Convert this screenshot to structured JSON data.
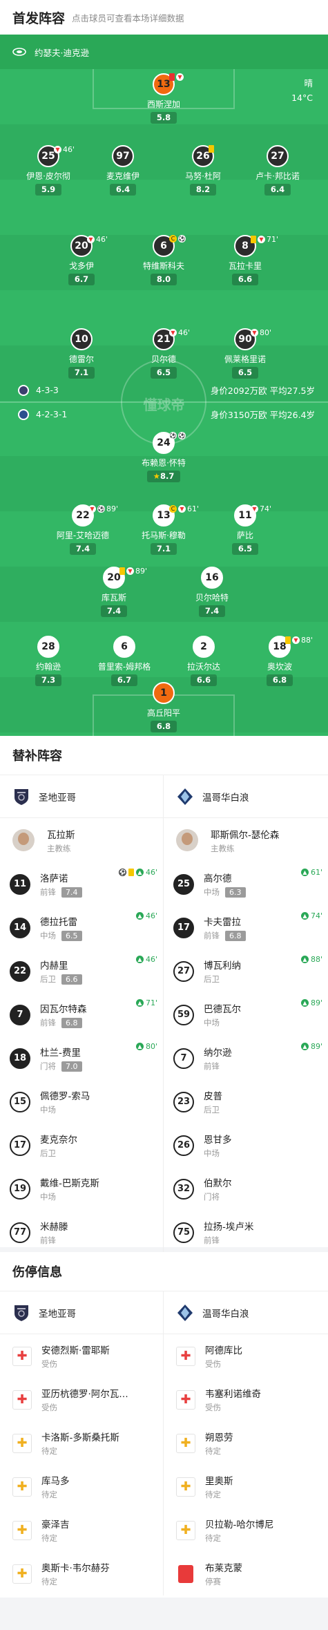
{
  "header": {
    "title": "首发阵容",
    "subtitle": "点击球员可查看本场详细数据"
  },
  "venue": {
    "name": "约瑟夫·迪克逊"
  },
  "weather": {
    "condition": "晴",
    "temp": "14°C"
  },
  "pitch": {
    "watermark": "懂球帝"
  },
  "home_team": {
    "formation": "4-3-3",
    "value": "身价2092万欧 平均27.5岁",
    "color": "#3b3f6e"
  },
  "away_team": {
    "formation": "4-2-3-1",
    "value": "身价3150万欧 平均26.4岁",
    "color": "#2c4f8e"
  },
  "home_players": [
    {
      "num": "13",
      "name": "西斯涅加",
      "rating": "5.8",
      "style": "gk",
      "events": [
        "red-card",
        "sub-out"
      ]
    },
    {
      "num": "25",
      "name": "伊恩·皮尔彻",
      "rating": "5.9",
      "style": "dark",
      "events": [
        "sub-out"
      ],
      "time": "46'"
    },
    {
      "num": "97",
      "name": "麦克维伊",
      "rating": "6.4",
      "style": "dark",
      "events": []
    },
    {
      "num": "26",
      "name": "马努·杜阿",
      "rating": "8.2",
      "style": "dark",
      "events": [
        "yellow-card"
      ]
    },
    {
      "num": "27",
      "name": "卢卡·邦比诺",
      "rating": "6.4",
      "style": "dark",
      "events": []
    },
    {
      "num": "20",
      "name": "戈多伊",
      "rating": "6.7",
      "style": "dark",
      "events": [
        "sub-out"
      ],
      "time": "46'"
    },
    {
      "num": "6",
      "name": "特维斯科夫",
      "rating": "8.0",
      "style": "dark",
      "events": [
        "captain",
        "ball"
      ]
    },
    {
      "num": "8",
      "name": "瓦拉卡里",
      "rating": "6.6",
      "style": "dark",
      "events": [
        "yellow-card",
        "sub-out"
      ],
      "time": "71'"
    },
    {
      "num": "10",
      "name": "德雷尔",
      "rating": "7.1",
      "style": "dark",
      "events": []
    },
    {
      "num": "21",
      "name": "贝尔德",
      "rating": "6.5",
      "style": "dark",
      "events": [
        "sub-out"
      ],
      "time": "46'"
    },
    {
      "num": "90",
      "name": "佩莱格里诺",
      "rating": "6.5",
      "style": "dark",
      "events": [
        "sub-out"
      ],
      "time": "80'"
    }
  ],
  "away_players": [
    {
      "num": "24",
      "name": "布赖恩·怀特",
      "rating": "8.7",
      "style": "light",
      "events": [
        "ball",
        "ball"
      ],
      "star": "★"
    },
    {
      "num": "22",
      "name": "阿里-艾哈迈德",
      "rating": "7.4",
      "style": "light",
      "events": [
        "sub-out",
        "ball"
      ],
      "time": "89'"
    },
    {
      "num": "13",
      "name": "托马斯·穆勒",
      "rating": "7.1",
      "style": "light",
      "events": [
        "captain",
        "sub-out"
      ],
      "time": "61'"
    },
    {
      "num": "11",
      "name": "萨比",
      "rating": "6.5",
      "style": "light",
      "events": [
        "sub-out"
      ],
      "time": "74'"
    },
    {
      "num": "20",
      "name": "库瓦斯",
      "rating": "7.4",
      "style": "light",
      "events": [
        "yellow-card",
        "sub-out"
      ],
      "time": "89'"
    },
    {
      "num": "16",
      "name": "贝尔哈特",
      "rating": "7.4",
      "style": "light",
      "events": []
    },
    {
      "num": "28",
      "name": "约翰逊",
      "rating": "7.3",
      "style": "light",
      "events": []
    },
    {
      "num": "6",
      "name": "普里索-姆邦格",
      "rating": "6.7",
      "style": "light",
      "events": []
    },
    {
      "num": "2",
      "name": "拉沃尔达",
      "rating": "6.6",
      "style": "light",
      "events": []
    },
    {
      "num": "18",
      "name": "奥坎波",
      "rating": "6.8",
      "style": "light",
      "events": [
        "yellow-card",
        "sub-out"
      ],
      "time": "88'"
    },
    {
      "num": "1",
      "name": "高丘阳平",
      "rating": "6.8",
      "style": "gk",
      "events": []
    }
  ],
  "subs": {
    "title": "替补阵容",
    "home": {
      "team": "圣地亚哥",
      "coach": "瓦拉斯",
      "coach_role": "主教练",
      "players": [
        {
          "num": "11",
          "name": "洛萨诺",
          "pos": "前锋",
          "rating": "7.4",
          "ev": "46'",
          "icons": [
            "ball",
            "yellow-card",
            "sub-in"
          ]
        },
        {
          "num": "14",
          "name": "德拉托雷",
          "pos": "中场",
          "rating": "6.5",
          "ev": "46'",
          "icons": [
            "sub-in"
          ]
        },
        {
          "num": "22",
          "name": "内赫里",
          "pos": "后卫",
          "rating": "6.6",
          "ev": "46'",
          "icons": [
            "sub-in"
          ]
        },
        {
          "num": "7",
          "name": "因瓦尔特森",
          "pos": "前锋",
          "rating": "6.8",
          "ev": "71'",
          "icons": [
            "sub-in"
          ]
        },
        {
          "num": "18",
          "name": "杜兰-费里",
          "pos": "门将",
          "rating": "7.0",
          "ev": "80'",
          "icons": [
            "sub-in"
          ]
        },
        {
          "num": "15",
          "name": "佩德罗-索马",
          "pos": "中场",
          "rating": "",
          "ev": "",
          "icons": []
        },
        {
          "num": "17",
          "name": "麦克奈尔",
          "pos": "后卫",
          "rating": "",
          "ev": "",
          "icons": []
        },
        {
          "num": "19",
          "name": "戴维-巴斯克斯",
          "pos": "中场",
          "rating": "",
          "ev": "",
          "icons": []
        },
        {
          "num": "77",
          "name": "米赫滕",
          "pos": "前锋",
          "rating": "",
          "ev": "",
          "icons": []
        }
      ]
    },
    "away": {
      "team": "温哥华白浪",
      "coach": "耶斯佩尔-瑟伦森",
      "coach_role": "主教练",
      "players": [
        {
          "num": "25",
          "name": "高尔德",
          "pos": "中场",
          "rating": "6.3",
          "ev": "61'",
          "icons": [
            "sub-in"
          ]
        },
        {
          "num": "17",
          "name": "卡夫雷拉",
          "pos": "前锋",
          "rating": "6.8",
          "ev": "74'",
          "icons": [
            "sub-in"
          ]
        },
        {
          "num": "27",
          "name": "博瓦利纳",
          "pos": "后卫",
          "rating": "",
          "ev": "88'",
          "icons": [
            "sub-in"
          ]
        },
        {
          "num": "59",
          "name": "巴德瓦尔",
          "pos": "中场",
          "rating": "",
          "ev": "89'",
          "icons": [
            "sub-in"
          ]
        },
        {
          "num": "7",
          "name": "纳尔逊",
          "pos": "前锋",
          "rating": "",
          "ev": "89'",
          "icons": [
            "sub-in"
          ]
        },
        {
          "num": "23",
          "name": "皮普",
          "pos": "后卫",
          "rating": "",
          "ev": "",
          "icons": []
        },
        {
          "num": "26",
          "name": "恩甘多",
          "pos": "中场",
          "rating": "",
          "ev": "",
          "icons": []
        },
        {
          "num": "32",
          "name": "伯默尔",
          "pos": "门将",
          "rating": "",
          "ev": "",
          "icons": []
        },
        {
          "num": "75",
          "name": "拉扬-埃卢米",
          "pos": "前锋",
          "rating": "",
          "ev": "",
          "icons": []
        }
      ]
    }
  },
  "injuries": {
    "title": "伤停信息",
    "home": {
      "team": "圣地亚哥",
      "players": [
        {
          "name": "安德烈斯·雷耶斯",
          "status": "受伤",
          "kind": "injury"
        },
        {
          "name": "亚历杭德罗·阿尔瓦…",
          "status": "受伤",
          "kind": "injury"
        },
        {
          "name": "卡洛斯-多斯桑托斯",
          "status": "待定",
          "kind": "doubt"
        },
        {
          "name": "库马多",
          "status": "待定",
          "kind": "doubt"
        },
        {
          "name": "豪泽吉",
          "status": "待定",
          "kind": "doubt"
        },
        {
          "name": "奥斯卡·韦尔赫芬",
          "status": "待定",
          "kind": "doubt"
        }
      ]
    },
    "away": {
      "team": "温哥华白浪",
      "players": [
        {
          "name": "阿德库比",
          "status": "受伤",
          "kind": "injury"
        },
        {
          "name": "韦塞利诺维奇",
          "status": "受伤",
          "kind": "injury"
        },
        {
          "name": "朔恩劳",
          "status": "待定",
          "kind": "doubt"
        },
        {
          "name": "里奥斯",
          "status": "待定",
          "kind": "doubt"
        },
        {
          "name": "贝拉勒-哈尔博尼",
          "status": "待定",
          "kind": "doubt"
        },
        {
          "name": "布莱克蒙",
          "status": "停赛",
          "kind": "suspended"
        }
      ]
    }
  }
}
